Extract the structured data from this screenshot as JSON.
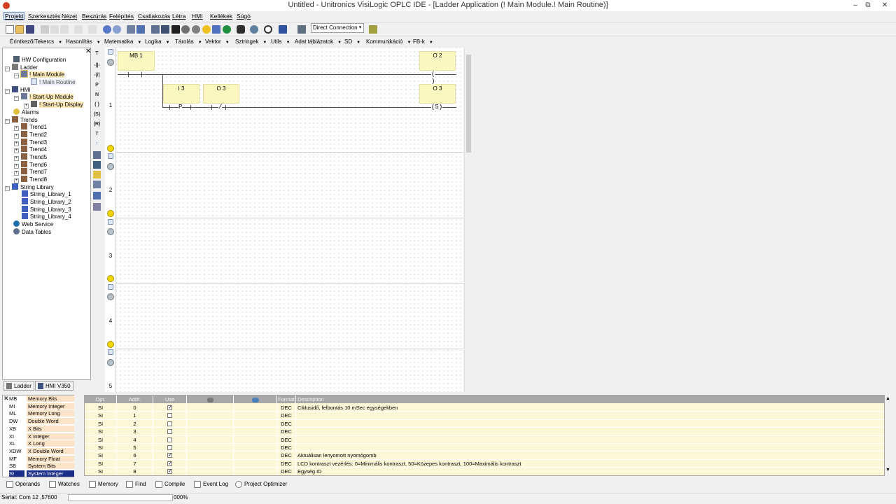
{
  "window": {
    "title": "Untitled - Unitronics VisiLogic OPLC IDE - [Ladder Application (! Main Module.! Main Routine)]",
    "controls": [
      "–",
      "⧉",
      "✕"
    ]
  },
  "menu": [
    "Projekt",
    "Szerkesztés",
    "Nézet",
    "Beszúrás",
    "Felépítés",
    "Csatlakozás",
    "Létra",
    "HMI",
    "Kellékek",
    "Súgó"
  ],
  "toolbar": {
    "connection": "Direct Connection"
  },
  "function_menu": [
    "Érintkező/Tekercs",
    "Hasonlítás",
    "Matematika",
    "Logika",
    "Tárolás",
    "Vektor",
    "Sztringek",
    "Utils",
    "Adat táblázatok",
    "SD",
    "Kommunikáció",
    "FB-k"
  ],
  "tree": {
    "hw_config": "HW Configuration",
    "ladder": "Ladder",
    "main_module": "! Main Module",
    "main_routine": "! Main Routine",
    "hmi": "HMI",
    "startup_module": "! Start-Up Module",
    "startup_display": "! Start-Up Display",
    "alarms": "Alarms",
    "trends": "Trends",
    "trend_items": [
      "Trend1",
      "Trend2",
      "Trend3",
      "Trend4",
      "Trend5",
      "Trend6",
      "Trend7",
      "Trend8"
    ],
    "string_library": "String Library",
    "string_items": [
      "String_Library_1",
      "String_Library_2",
      "String_Library_3",
      "String_Library_4"
    ],
    "web_service": "Web Service",
    "data_tables": "Data Tables",
    "tabs": [
      "Ladder",
      "HMI V350"
    ]
  },
  "ladder": {
    "rung_numbers": [
      "1",
      "2",
      "3",
      "4",
      "5"
    ],
    "ops": {
      "mb1": "MB 1",
      "o2": "O 2",
      "i3": "I 3",
      "o3a": "O 3",
      "o3b": "O 3"
    },
    "symbols": {
      "coil": "(   )",
      "set_coil": "(S)",
      "pos": "P",
      "neg": "/"
    }
  },
  "operands": [
    {
      "code": "MB",
      "name": "Memory Bits"
    },
    {
      "code": "MI",
      "name": "Memory Integer"
    },
    {
      "code": "ML",
      "name": "Memory Long"
    },
    {
      "code": "DW",
      "name": "Double Word"
    },
    {
      "code": "XB",
      "name": "X Bits"
    },
    {
      "code": "XI",
      "name": "X Integer"
    },
    {
      "code": "XL",
      "name": "X Long"
    },
    {
      "code": "XDW",
      "name": "X Double Word"
    },
    {
      "code": "MF",
      "name": "Memory Float"
    },
    {
      "code": "SB",
      "name": "System Bits"
    },
    {
      "code": "SI",
      "name": "System Integer"
    }
  ],
  "table": {
    "headers": [
      "Opr.",
      "Addr.",
      "Use",
      "",
      "",
      "Format",
      "Description"
    ],
    "rows": [
      {
        "opr": "SI",
        "addr": "0",
        "use": true,
        "fmt": "DEC",
        "desc": "Ciklusidő, felbontás 10 mSec egységekben"
      },
      {
        "opr": "SI",
        "addr": "1",
        "use": false,
        "fmt": "DEC",
        "desc": ""
      },
      {
        "opr": "SI",
        "addr": "2",
        "use": false,
        "fmt": "DEC",
        "desc": ""
      },
      {
        "opr": "SI",
        "addr": "3",
        "use": false,
        "fmt": "DEC",
        "desc": ""
      },
      {
        "opr": "SI",
        "addr": "4",
        "use": false,
        "fmt": "DEC",
        "desc": ""
      },
      {
        "opr": "SI",
        "addr": "5",
        "use": false,
        "fmt": "DEC",
        "desc": ""
      },
      {
        "opr": "SI",
        "addr": "6",
        "use": true,
        "fmt": "DEC",
        "desc": "Aktuálisan lenyomott nyomógomb"
      },
      {
        "opr": "SI",
        "addr": "7",
        "use": true,
        "fmt": "DEC",
        "desc": "LCD kontraszt vezérlés: 0=Minimális kontraszt, 50=Közepes kontraszt, 100=Maximális kontraszt"
      },
      {
        "opr": "SI",
        "addr": "8",
        "use": true,
        "fmt": "DEC",
        "desc": "Egység ID"
      }
    ]
  },
  "bottom_tabs": [
    "Operands",
    "Watches",
    "Memory",
    "Find",
    "Compile",
    "Event Log",
    "Project Optimizer"
  ],
  "status": {
    "serial": "Serial:  Com 12 ,57600",
    "zoom": "000%"
  }
}
